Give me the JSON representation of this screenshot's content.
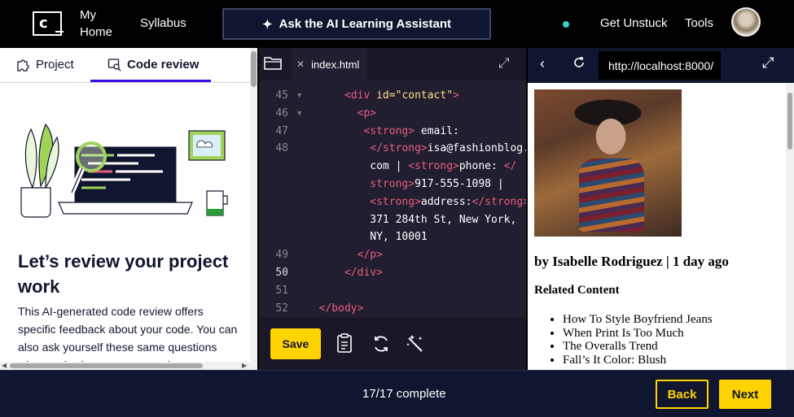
{
  "nav": {
    "logo_text": "c",
    "my_home": "My Home",
    "syllabus": "Syllabus",
    "ai_assistant": "Ask the AI Learning Assistant",
    "get_unstuck": "Get Unstuck",
    "tools": "Tools",
    "status_dot_color": "#3ad0c5"
  },
  "left_panel": {
    "tabs": [
      {
        "label": "Project",
        "icon": "puzzle-icon"
      },
      {
        "label": "Code review",
        "icon": "code-review-icon",
        "active": true
      }
    ],
    "headline": "Let’s review your project work",
    "body": "This AI-generated code review offers specific feedback about your code. You can also ask yourself these same questions when reviewing your own work."
  },
  "editor": {
    "file_tab": "index.html",
    "lines": [
      {
        "num": "45",
        "fold": true,
        "html": "      <span class=\"t\">&lt;div</span> <span class=\"a\">id=</span><span class=\"s\">\"contact\"</span><span class=\"t\">&gt;</span>"
      },
      {
        "num": "46",
        "fold": true,
        "html": "        <span class=\"t\">&lt;p&gt;</span>"
      },
      {
        "num": "47",
        "fold": false,
        "html": "         <span class=\"t\">&lt;strong&gt;</span> email:"
      },
      {
        "num": "48",
        "fold": false,
        "html": "          <span class=\"t\">&lt;/strong&gt;</span>isa@fashionblog."
      },
      {
        "num": "",
        "fold": false,
        "html": "          com | <span class=\"t\">&lt;strong&gt;</span>phone: <span class=\"t\">&lt;/</span>"
      },
      {
        "num": "",
        "fold": false,
        "html": "          <span class=\"t\">strong&gt;</span>917-555-1098 |"
      },
      {
        "num": "",
        "fold": false,
        "html": "          <span class=\"t\">&lt;strong&gt;</span>address:<span class=\"t\">&lt;/strong&gt;</span>"
      },
      {
        "num": "",
        "fold": false,
        "html": "          371 284th St, New York,"
      },
      {
        "num": "",
        "fold": false,
        "html": "          NY, 10001"
      },
      {
        "num": "49",
        "fold": false,
        "html": "        <span class=\"t\">&lt;/p&gt;</span>"
      },
      {
        "num": "50",
        "fold": false,
        "html": "      <span class=\"t\">&lt;/div&gt;</span>",
        "active": true
      },
      {
        "num": "51",
        "fold": false,
        "html": ""
      },
      {
        "num": "52",
        "fold": false,
        "html": "  <span class=\"t\">&lt;/body&gt;</span>"
      }
    ],
    "save_label": "Save"
  },
  "browser": {
    "url": "http://localhost:8000/",
    "byline": "by Isabelle Rodriguez | 1 day ago",
    "related_heading": "Related Content",
    "related_items": [
      "How To Style Boyfriend Jeans",
      "When Print Is Too Much",
      "The Overalls Trend",
      "Fall’s It Color: Blush"
    ]
  },
  "footer": {
    "progress": "17/17 complete",
    "back_label": "Back",
    "next_label": "Next"
  },
  "colors": {
    "accent_yellow": "#ffd300",
    "navy": "#10162f",
    "tab_underline": "#3a10e5"
  }
}
